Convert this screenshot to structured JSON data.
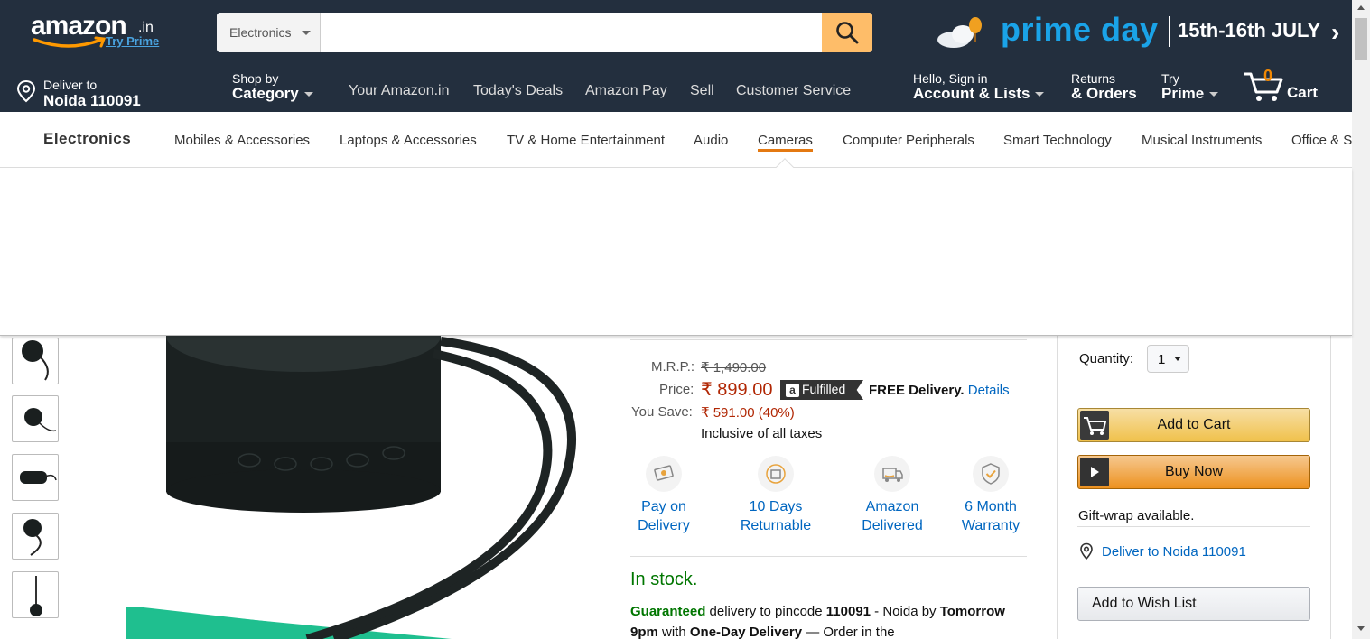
{
  "logo": {
    "text": "amazon",
    "suffix": ".in",
    "tagline": "Try Prime"
  },
  "search": {
    "category": "Electronics",
    "placeholder": ""
  },
  "banner": {
    "prime_day": "prime day",
    "dates": "15th-16th JULY"
  },
  "nav": {
    "deliver_line1": "Deliver to",
    "deliver_line2": "Noida 110091",
    "shop_line1": "Shop by",
    "shop_line2": "Category",
    "links": [
      "Your Amazon.in",
      "Today's Deals",
      "Amazon Pay",
      "Sell",
      "Customer Service"
    ],
    "account_line1": "Hello, Sign in",
    "account_line2": "Account & Lists",
    "returns_line1": "Returns",
    "returns_line2": "& Orders",
    "prime_line1": "Try",
    "prime_line2": "Prime",
    "cart_count": "0",
    "cart_label": "Cart"
  },
  "subnav": {
    "title": "Electronics",
    "items": [
      "Mobiles & Accessories",
      "Laptops & Accessories",
      "TV & Home Entertainment",
      "Audio",
      "Cameras",
      "Computer Peripherals",
      "Smart Technology",
      "Musical Instruments",
      "Office & S"
    ],
    "active_index": 4
  },
  "price": {
    "mrp_label": "M.R.P.:",
    "mrp_value": "₹ 1,490.00",
    "price_label": "Price:",
    "price_value": "₹ 899.00",
    "fulfilled": "Fulfilled",
    "free_delivery": "FREE Delivery.",
    "details": "Details",
    "save_label": "You Save:",
    "save_value": "₹ 591.00 (40%)",
    "taxes": "Inclusive of all taxes"
  },
  "features": [
    {
      "line1": "Pay on",
      "line2": "Delivery",
      "icon": "cash-icon"
    },
    {
      "line1": "10 Days",
      "line2": "Returnable",
      "icon": "return-icon"
    },
    {
      "line1": "Amazon",
      "line2": "Delivered",
      "icon": "truck-icon"
    },
    {
      "line1": "6 Month",
      "line2": "Warranty",
      "icon": "shield-icon"
    }
  ],
  "stock": {
    "status": "In stock.",
    "guaranteed": "Guaranteed",
    "text1": " delivery to pincode ",
    "pincode": "110091",
    "text2": " - Noida by ",
    "time": "Tomorrow 9pm",
    "text3": " with ",
    "one_day": "One-Day Delivery",
    "text4": " — Order in the"
  },
  "buybox": {
    "qty_label": "Quantity:",
    "qty_value": "1",
    "add_to_cart": "Add to Cart",
    "buy_now": "Buy Now",
    "gift_wrap": "Gift-wrap available.",
    "deliver_to": "Deliver to Noida 110091",
    "wish_list": "Add to Wish List"
  },
  "colors": {
    "nav_bg": "#232f3e",
    "search_btn": "#febd69",
    "accent_orange": "#e47911",
    "price_red": "#b12704",
    "link_blue": "#0066c0",
    "stock_green": "#007600"
  }
}
